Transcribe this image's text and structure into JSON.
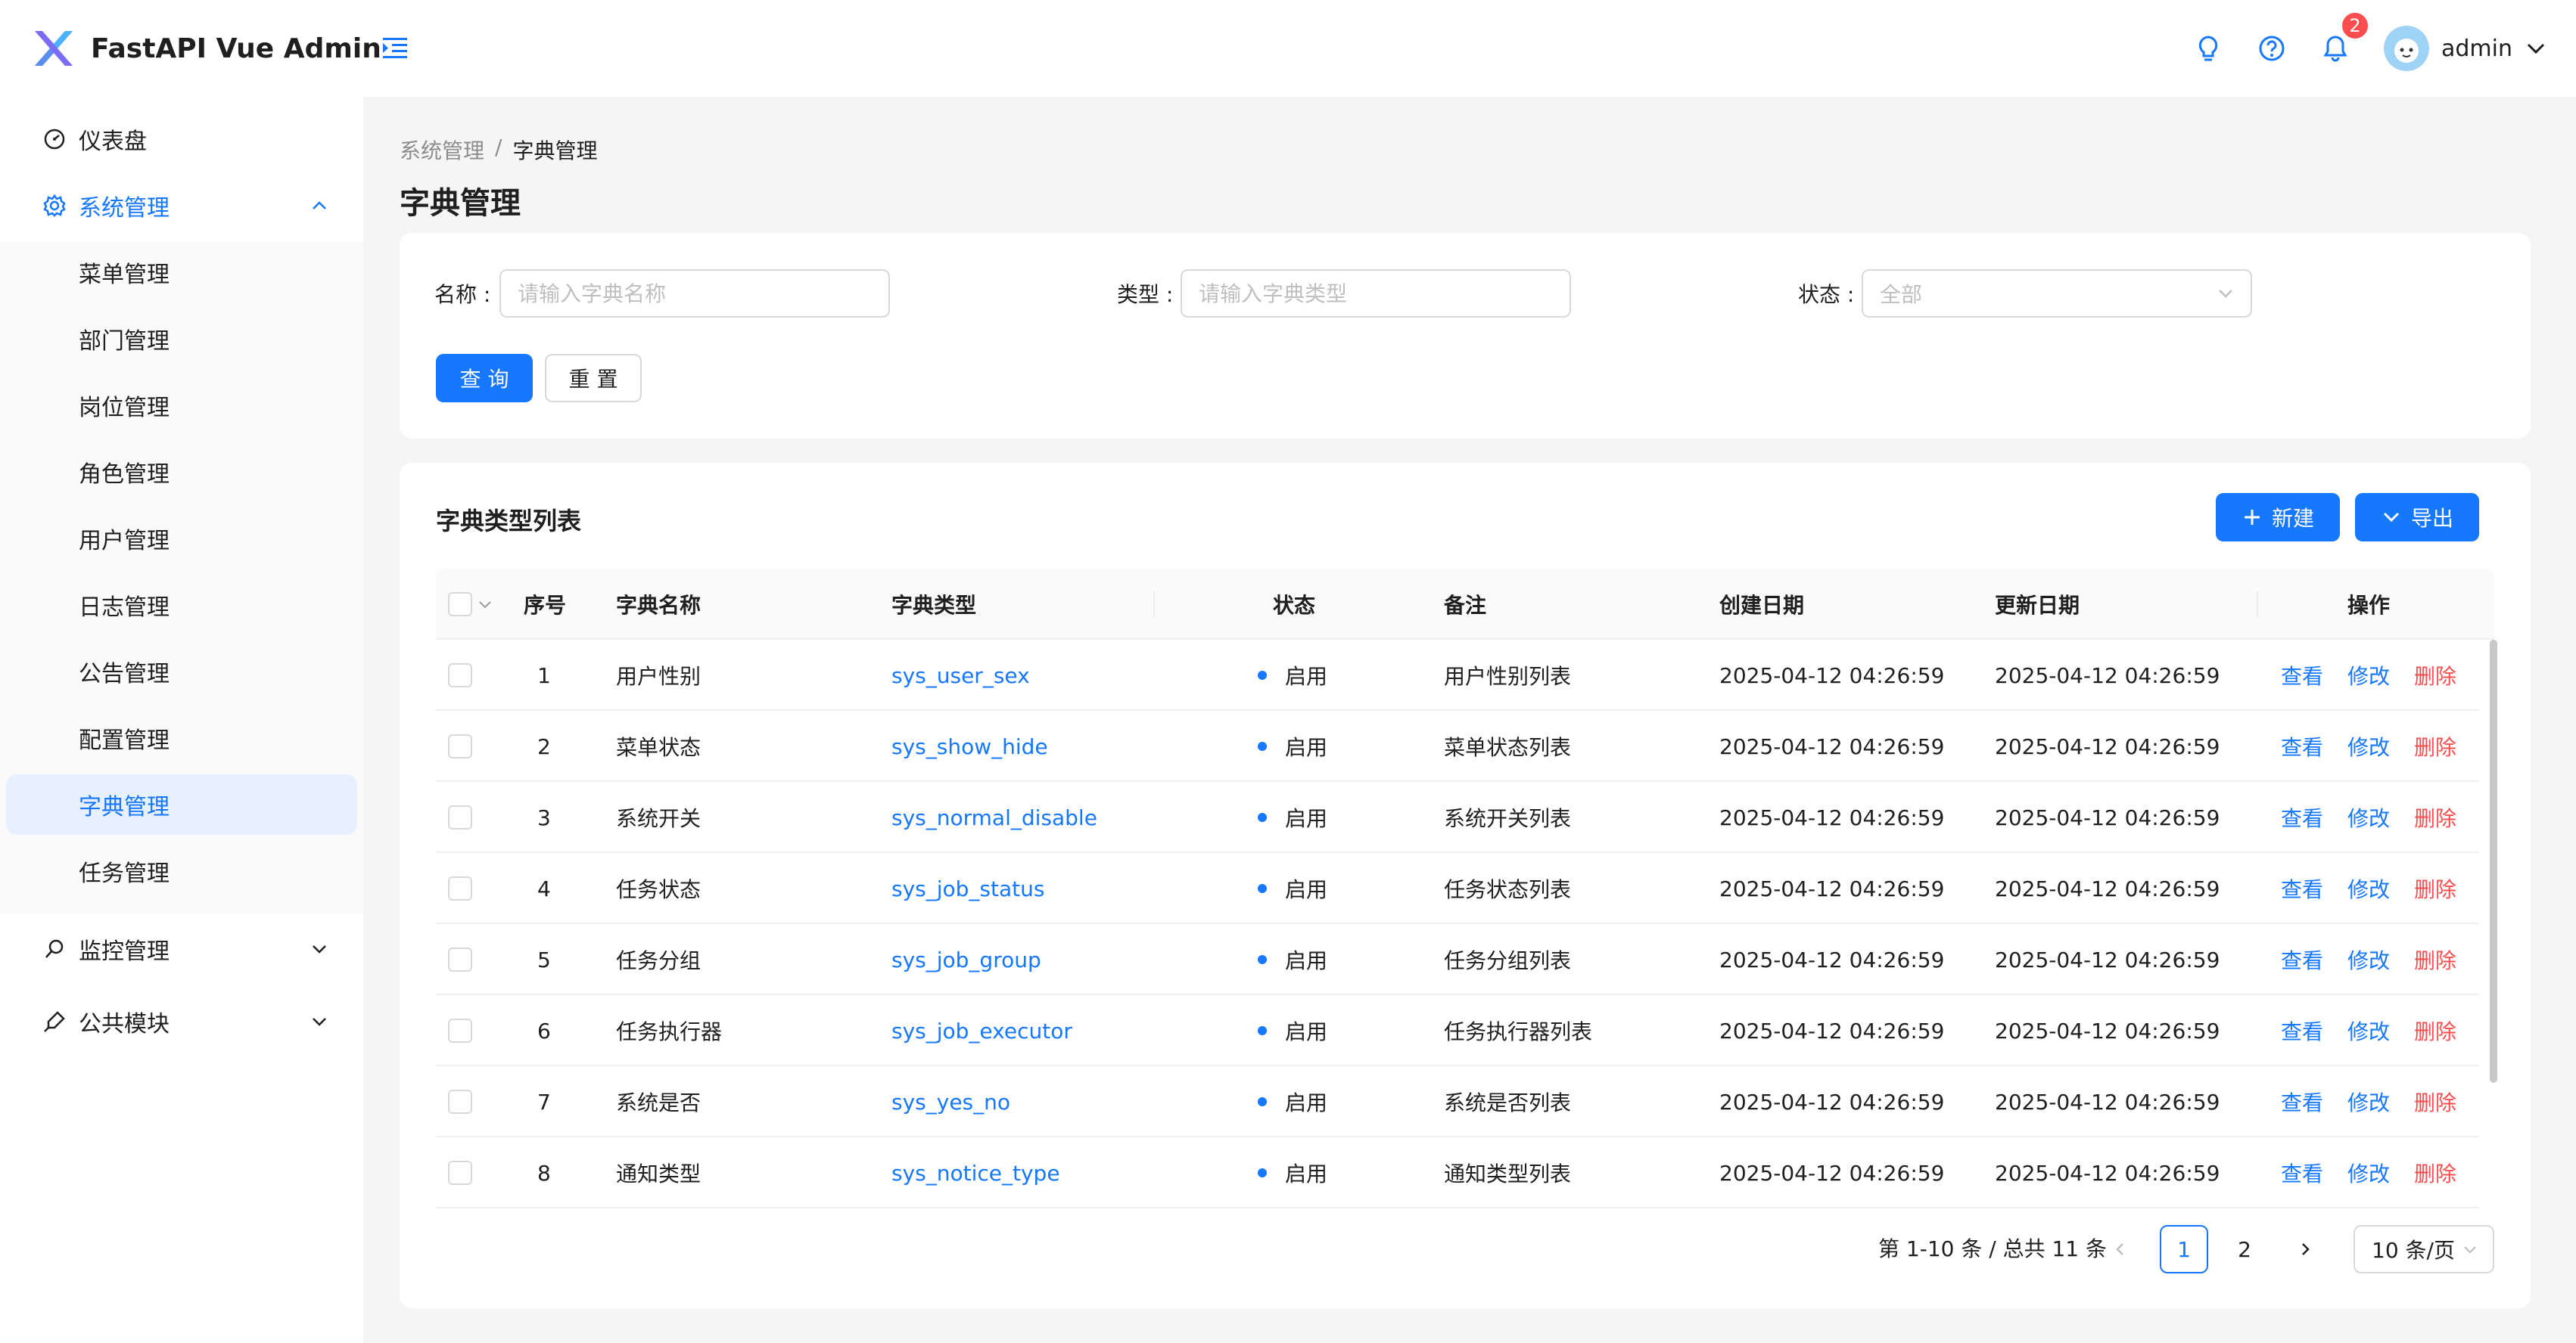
{
  "brand": {
    "title": "FastAPI Vue Admin"
  },
  "header": {
    "notification_count": "2",
    "user_name": "admin"
  },
  "sidebar": {
    "items": [
      {
        "label": "仪表盘",
        "icon": "dashboard-icon"
      },
      {
        "label": "系统管理",
        "icon": "gear-icon",
        "expanded": true
      },
      {
        "label": "监控管理",
        "icon": "monitor-icon"
      },
      {
        "label": "公共模块",
        "icon": "module-icon"
      }
    ],
    "system_children": [
      "菜单管理",
      "部门管理",
      "岗位管理",
      "角色管理",
      "用户管理",
      "日志管理",
      "公告管理",
      "配置管理",
      "字典管理",
      "任务管理"
    ],
    "active_child": "字典管理"
  },
  "breadcrumb": {
    "parent": "系统管理",
    "separator": "/",
    "current": "字典管理"
  },
  "page": {
    "title": "字典管理"
  },
  "search": {
    "name_label": "名称 :",
    "name_placeholder": "请输入字典名称",
    "type_label": "类型 :",
    "type_placeholder": "请输入字典类型",
    "status_label": "状态 :",
    "status_value": "全部",
    "query_label": "查 询",
    "reset_label": "重 置"
  },
  "table": {
    "title": "字典类型列表",
    "new_label": "新建",
    "export_label": "导出",
    "columns": [
      "序号",
      "字典名称",
      "字典类型",
      "状态",
      "备注",
      "创建日期",
      "更新日期",
      "操作"
    ],
    "actions": {
      "view": "查看",
      "edit": "修改",
      "delete": "删除"
    },
    "rows": [
      {
        "index": "1",
        "name": "用户性别",
        "type": "sys_user_sex",
        "status": "启用",
        "remark": "用户性别列表",
        "created": "2025-04-12 04:26:59",
        "updated": "2025-04-12 04:26:59"
      },
      {
        "index": "2",
        "name": "菜单状态",
        "type": "sys_show_hide",
        "status": "启用",
        "remark": "菜单状态列表",
        "created": "2025-04-12 04:26:59",
        "updated": "2025-04-12 04:26:59"
      },
      {
        "index": "3",
        "name": "系统开关",
        "type": "sys_normal_disable",
        "status": "启用",
        "remark": "系统开关列表",
        "created": "2025-04-12 04:26:59",
        "updated": "2025-04-12 04:26:59"
      },
      {
        "index": "4",
        "name": "任务状态",
        "type": "sys_job_status",
        "status": "启用",
        "remark": "任务状态列表",
        "created": "2025-04-12 04:26:59",
        "updated": "2025-04-12 04:26:59"
      },
      {
        "index": "5",
        "name": "任务分组",
        "type": "sys_job_group",
        "status": "启用",
        "remark": "任务分组列表",
        "created": "2025-04-12 04:26:59",
        "updated": "2025-04-12 04:26:59"
      },
      {
        "index": "6",
        "name": "任务执行器",
        "type": "sys_job_executor",
        "status": "启用",
        "remark": "任务执行器列表",
        "created": "2025-04-12 04:26:59",
        "updated": "2025-04-12 04:26:59"
      },
      {
        "index": "7",
        "name": "系统是否",
        "type": "sys_yes_no",
        "status": "启用",
        "remark": "系统是否列表",
        "created": "2025-04-12 04:26:59",
        "updated": "2025-04-12 04:26:59"
      },
      {
        "index": "8",
        "name": "通知类型",
        "type": "sys_notice_type",
        "status": "启用",
        "remark": "通知类型列表",
        "created": "2025-04-12 04:26:59",
        "updated": "2025-04-12 04:26:59"
      }
    ]
  },
  "pagination": {
    "total_text": "第 1-10 条 / 总共 11 条",
    "pages": [
      "1",
      "2"
    ],
    "current_page": "1",
    "page_size": "10 条/页"
  },
  "colors": {
    "primary": "#1677ff",
    "danger": "#ff4d4f",
    "active_bg": "#e6f0ff"
  }
}
